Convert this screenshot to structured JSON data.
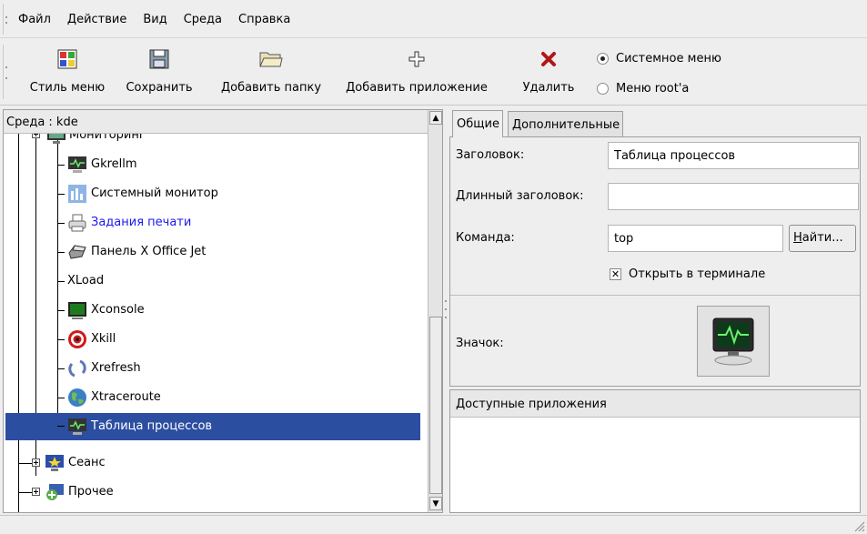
{
  "menubar": {
    "items": [
      {
        "label": "Файл",
        "key": "file"
      },
      {
        "label": "Действие",
        "key": "action"
      },
      {
        "label": "Вид",
        "key": "view"
      },
      {
        "label": "Среда",
        "key": "environment"
      },
      {
        "label": "Справка",
        "key": "help"
      }
    ]
  },
  "toolbar": {
    "menu_style": "Стиль меню",
    "save": "Сохранить",
    "add_folder": "Добавить папку",
    "add_app": "Добавить приложение",
    "delete": "Удалить",
    "radio_system": "Системное меню",
    "radio_root": "Меню root'а",
    "radio_selected": "system"
  },
  "tree": {
    "header": "Среда : kde",
    "parent_label": "Мониторинг",
    "items": [
      {
        "label": "Gkrellm",
        "icon": "gkrellm-icon"
      },
      {
        "label": "Системный монитор",
        "icon": "system-monitor-icon"
      },
      {
        "label": "Задания печати",
        "icon": "printer-icon",
        "color": "#1a1aee"
      },
      {
        "label": "Панель X Office Jet",
        "icon": "officejet-icon"
      },
      {
        "label": "XLoad",
        "icon": ""
      },
      {
        "label": "Xconsole",
        "icon": "console-icon"
      },
      {
        "label": "Xkill",
        "icon": "xkill-target-icon"
      },
      {
        "label": "Xrefresh",
        "icon": "refresh-icon"
      },
      {
        "label": "Xtraceroute",
        "icon": "globe-icon"
      },
      {
        "label": "Таблица процессов",
        "icon": "process-table-icon",
        "selected": true
      }
    ],
    "siblings": [
      {
        "label": "Сеанс",
        "icon": "session-icon"
      },
      {
        "label": "Прочее",
        "icon": "misc-icon"
      }
    ]
  },
  "props": {
    "tab_general": "Общие",
    "tab_advanced": "Дополнительные",
    "title_label": "Заголовок:",
    "title_value": "Таблица процессов",
    "long_title_label": "Длинный заголовок:",
    "long_title_value": "",
    "command_label": "Команда:",
    "command_value": "top",
    "find_prefix": "Н",
    "find_rest": "айти...",
    "open_in_terminal": "Открыть в терминале",
    "open_in_terminal_checked": true,
    "icon_label": "Значок:",
    "available_apps_header": "Доступные приложения"
  },
  "colors": {
    "selection": "#2c4ea1",
    "link": "#1a1aee"
  }
}
